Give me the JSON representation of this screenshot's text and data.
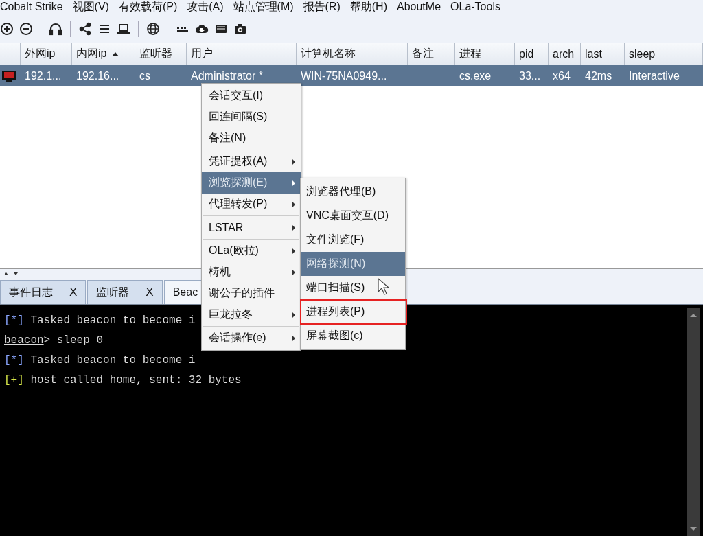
{
  "menu_bar": [
    "Cobalt Strike",
    "视图(V)",
    "有效载荷(P)",
    "攻击(A)",
    "站点管理(M)",
    "报告(R)",
    "帮助(H)",
    "AboutMe",
    "OLa-Tools"
  ],
  "table": {
    "columns": [
      {
        "sorted": false
      },
      {
        "label": "外网ip",
        "sorted": false
      },
      {
        "label": "内网ip",
        "sorted": true
      },
      {
        "label": "监听器",
        "sorted": false
      },
      {
        "label": "用户",
        "sorted": false
      },
      {
        "label": "计算机名称",
        "sorted": false
      },
      {
        "label": "备注",
        "sorted": false
      },
      {
        "label": "进程",
        "sorted": false
      },
      {
        "label": "pid",
        "sorted": false
      },
      {
        "label": "arch",
        "sorted": false
      },
      {
        "label": "last",
        "sorted": false
      },
      {
        "label": "sleep",
        "sorted": false
      }
    ],
    "rows": [
      {
        "selected": true,
        "cells": [
          "",
          "192.1...",
          "192.16...",
          "cs",
          "Administrator *",
          "WIN-75NA0949...",
          "",
          "cs.exe",
          "33...",
          "x64",
          "42ms",
          "Interactive"
        ]
      }
    ]
  },
  "tabs": [
    {
      "label": "事件日志",
      "close": "X",
      "selected": false
    },
    {
      "label": "监听器",
      "close": "X",
      "selected": false
    },
    {
      "label": "Beac",
      "selected": true
    }
  ],
  "console": [
    {
      "kind": "status",
      "mark": "[*]",
      "text": "Tasked beacon to become i"
    },
    {
      "kind": "prompt",
      "mark": "beacon",
      "text": "> sleep 0"
    },
    {
      "kind": "status",
      "mark": "[*]",
      "text": "Tasked beacon to become i"
    },
    {
      "kind": "success",
      "mark": "[+]",
      "text": "host called home, sent: 32 bytes"
    }
  ],
  "context_menu": {
    "groups": [
      [
        {
          "label": "会话交互(I)",
          "submenu": false,
          "selected": false
        },
        {
          "label": "回连间隔(S)",
          "submenu": false,
          "selected": false
        },
        {
          "label": "备注(N)",
          "submenu": false,
          "selected": false
        }
      ],
      [
        {
          "label": "凭证提权(A)",
          "submenu": true,
          "selected": false
        },
        {
          "label": "浏览探测(E)",
          "submenu": true,
          "selected": true
        },
        {
          "label": "代理转发(P)",
          "submenu": true,
          "selected": false
        }
      ],
      [
        {
          "label": "LSTAR",
          "submenu": true,
          "selected": false
        }
      ],
      [
        {
          "label": "OLa(欧拉)",
          "submenu": true,
          "selected": false
        },
        {
          "label": "梼机",
          "submenu": true,
          "selected": false
        },
        {
          "label": "谢公子的插件",
          "submenu": false,
          "selected": false
        },
        {
          "label": "巨龙拉冬",
          "submenu": true,
          "selected": false
        }
      ],
      [
        {
          "label": "会话操作(e)",
          "submenu": true,
          "selected": false
        }
      ]
    ]
  },
  "submenu": [
    {
      "label": "浏览器代理(B)",
      "selected": false,
      "highlighted": false
    },
    {
      "label": "VNC桌面交互(D)",
      "selected": false,
      "highlighted": false
    },
    {
      "label": "文件浏览(F)",
      "selected": false,
      "highlighted": false
    },
    {
      "label": "网络探测(N)",
      "selected": true,
      "highlighted": false
    },
    {
      "label": "端口扫描(S)",
      "selected": false,
      "highlighted": false
    },
    {
      "label": "进程列表(P)",
      "selected": false,
      "highlighted": true
    },
    {
      "label": "屏幕截图(c)",
      "selected": false,
      "highlighted": false
    }
  ]
}
